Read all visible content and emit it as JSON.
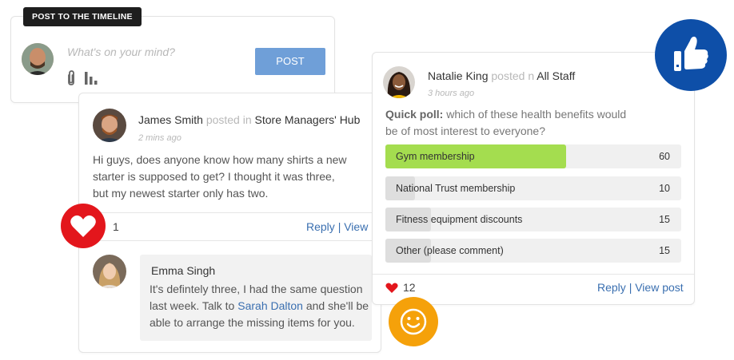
{
  "composer": {
    "tab_label": "POST TO THE TIMELINE",
    "placeholder": "What's on your mind?",
    "post_button": "POST",
    "icons": [
      "paperclip-icon",
      "bar-chart-icon"
    ]
  },
  "james_post": {
    "author": "James Smith",
    "verb": "posted in",
    "group": "Store Managers' Hub",
    "time": "2 mins ago",
    "body_lines": [
      "Hi guys, does anyone know how many shirts a new",
      "starter is supposed to get? I thought it was three,",
      "but my newest starter only has two."
    ],
    "like_count": "1",
    "reply_label": "Reply",
    "separator": "|",
    "view_label": "View",
    "comment": {
      "author": "Emma Singh",
      "line1": "It's defintely three, I had the same question",
      "line2": "last week. Talk to",
      "mention": "Sarah Dalton",
      "line2_tail": "and she'll be",
      "line3": "able to arrange the missing items for you."
    }
  },
  "natalie_post": {
    "author": "Natalie King",
    "verb": "posted n",
    "group": "All Staff",
    "time": "3 hours ago",
    "question_label": "Quick poll:",
    "question_line1": "which of these health benefits would",
    "question_line2": "be of most interest to everyone?",
    "poll": [
      {
        "label": "Gym membership",
        "count": "60",
        "fill_fraction": 0.61,
        "color": "#a4dd4f"
      },
      {
        "label": "National Trust membership",
        "count": "10",
        "fill_fraction": 0.1,
        "color": "#dedede"
      },
      {
        "label": "Fitness equipment discounts",
        "count": "15",
        "fill_fraction": 0.155,
        "color": "#dedede"
      },
      {
        "label": "Other (please comment)",
        "count": "15",
        "fill_fraction": 0.155,
        "color": "#dedede"
      }
    ],
    "like_count": "12",
    "reply_label": "Reply",
    "separator": "|",
    "view_label": "View post"
  },
  "colors": {
    "thumbs_badge": "#0e4fa8",
    "heart_badge": "#e3161c",
    "smile_badge": "#f5a10a",
    "link": "#3a6fb0",
    "post_button": "#6f9fd8",
    "poll_winner": "#a4dd4f"
  }
}
